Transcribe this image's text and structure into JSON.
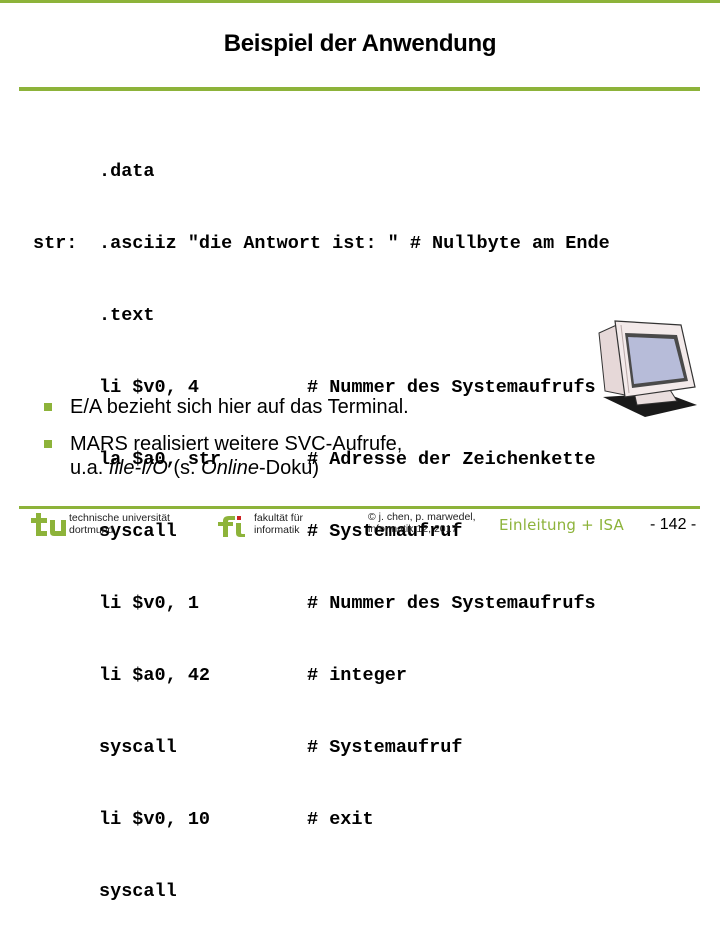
{
  "slide": {
    "title": "Beispiel der Anwendung",
    "accent_color": "#8db33a"
  },
  "code": {
    "lines": [
      {
        "label": "",
        "instr": ".data",
        "comment": ""
      },
      {
        "label": "str:",
        "instr": ".asciiz \"die Antwort ist: \" # Nullbyte am Ende",
        "comment": ""
      },
      {
        "label": "",
        "instr": ".text",
        "comment": ""
      },
      {
        "label": "",
        "instr": "li $v0, 4",
        "comment": "# Nummer des Systemaufrufs"
      },
      {
        "label": "",
        "instr": "la $a0, str",
        "comment": "# Adresse der Zeichenkette"
      },
      {
        "label": "",
        "instr": "syscall",
        "comment": "# Systemaufruf"
      },
      {
        "label": "",
        "instr": "li $v0, 1",
        "comment": "# Nummer des Systemaufrufs"
      },
      {
        "label": "",
        "instr": "li $a0, 42",
        "comment": "# integer"
      },
      {
        "label": "",
        "instr": "syscall",
        "comment": "# Systemaufruf"
      },
      {
        "label": "",
        "instr": "li $v0, 10",
        "comment": "# exit"
      },
      {
        "label": "",
        "instr": "syscall",
        "comment": ""
      }
    ]
  },
  "image": {
    "icon": "crt-monitor-icon"
  },
  "bullets": [
    {
      "parts": [
        {
          "text": "E/A bezieht sich hier auf  das Terminal.",
          "italic": false
        }
      ]
    },
    {
      "parts": [
        {
          "text": "MARS realisiert weitere SVC-Aufrufe,",
          "italic": false
        },
        {
          "text": "u.a. ",
          "italic": false,
          "newline": true
        },
        {
          "text": "file-I/O",
          "italic": true
        },
        {
          "text": " (s. ",
          "italic": false
        },
        {
          "text": "Online",
          "italic": true
        },
        {
          "text": "-Doku)",
          "italic": false
        }
      ]
    }
  ],
  "footer": {
    "university_line1": "technische universität",
    "university_line2": "dortmund",
    "faculty_line1": "fakultät für",
    "faculty_line2": "informatik",
    "copyright_line1": "© j. chen, p. marwedel,",
    "copyright_line2": "informatik 12,  2017",
    "lecture": "Einleitung + ISA",
    "page": "-  142 -"
  }
}
